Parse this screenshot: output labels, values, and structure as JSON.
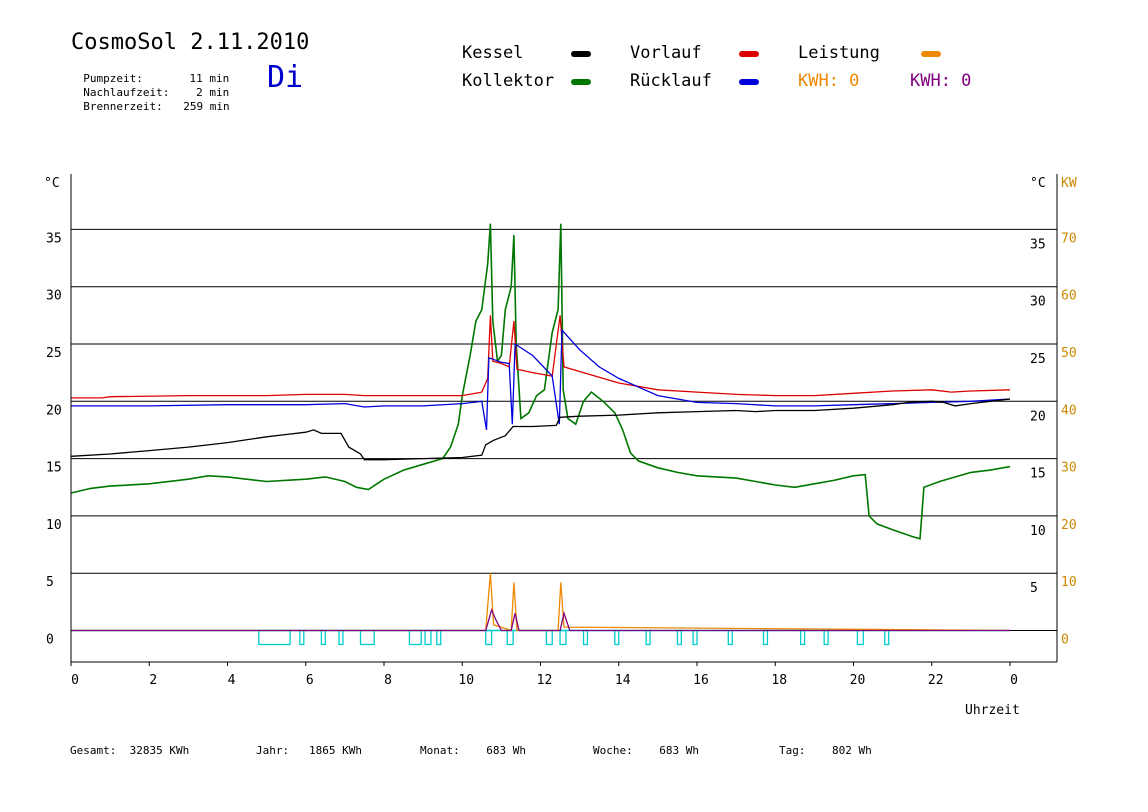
{
  "header": {
    "title": "CosmoSol 2.11.2010",
    "day": "Di",
    "pumpzeit_label": "Pumpzeit:",
    "pumpzeit_value": "11 min",
    "nachlaufzeit_label": "Nachlaufzeit:",
    "nachlaufzeit_value": "2 min",
    "brennerzeit_label": "Brennerzeit:",
    "brennerzeit_value": "259 min"
  },
  "legend": {
    "kessel": "Kessel",
    "kollektor": "Kollektor",
    "vorlauf": "Vorlauf",
    "ruecklauf": "Rücklauf",
    "leistung": "Leistung",
    "kwh1": "KWH: 0",
    "kwh2": "KWH: 0"
  },
  "footer": {
    "gesamt_label": "Gesamt:",
    "gesamt_value": "32835 KWh",
    "jahr_label": "Jahr:",
    "jahr_value": "1865 KWh",
    "monat_label": "Monat:",
    "monat_value": "683 Wh",
    "woche_label": "Woche:",
    "woche_value": "683 Wh",
    "tag_label": "Tag:",
    "tag_value": "802 Wh"
  },
  "colors": {
    "kessel": "#000000",
    "kollektor": "#007700",
    "vorlauf": "#dd0000",
    "ruecklauf": "#0000dd",
    "leistung": "#ee8800",
    "kwh2": "#800080",
    "pump": "#00cccc",
    "axis_right_kw": "#cc8800"
  },
  "chart_data": {
    "type": "line",
    "x_unit_label": "Uhrzeit",
    "y_unit_left": "°C",
    "y_unit_right": "°C",
    "y2_unit": "KW",
    "xlim": [
      0,
      24
    ],
    "ylim": [
      -3,
      40
    ],
    "grid": "horizontal",
    "x_ticks": [
      {
        "v": 0,
        "label": "0"
      },
      {
        "v": 2,
        "label": "2"
      },
      {
        "v": 4,
        "label": "4"
      },
      {
        "v": 6,
        "label": "6"
      },
      {
        "v": 8,
        "label": "8"
      },
      {
        "v": 10,
        "label": "10"
      },
      {
        "v": 12,
        "label": "12"
      },
      {
        "v": 14,
        "label": "14"
      },
      {
        "v": 16,
        "label": "16"
      },
      {
        "v": 18,
        "label": "18"
      },
      {
        "v": 20,
        "label": "20"
      },
      {
        "v": 22,
        "label": "22"
      },
      {
        "v": 24,
        "label": "0"
      }
    ],
    "y_ticks": [
      0,
      5,
      10,
      15,
      20,
      25,
      30,
      35
    ],
    "y2_ticks": [
      {
        "v": 0,
        "label": "0"
      },
      {
        "v": 5,
        "label": "10"
      },
      {
        "v": 10,
        "label": "20"
      },
      {
        "v": 15,
        "label": "30"
      },
      {
        "v": 20,
        "label": "40"
      },
      {
        "v": 25,
        "label": "50"
      },
      {
        "v": 30,
        "label": "60"
      },
      {
        "v": 35,
        "label": "70"
      }
    ],
    "series": [
      {
        "name": "Kessel",
        "key": "kessel",
        "points": [
          [
            0,
            15.2
          ],
          [
            1,
            15.4
          ],
          [
            2,
            15.7
          ],
          [
            3,
            16.0
          ],
          [
            4,
            16.4
          ],
          [
            5,
            16.9
          ],
          [
            5.5,
            17.1
          ],
          [
            6,
            17.3
          ],
          [
            6.2,
            17.5
          ],
          [
            6.4,
            17.2
          ],
          [
            6.9,
            17.2
          ],
          [
            7.1,
            16.0
          ],
          [
            7.4,
            15.4
          ],
          [
            7.5,
            14.9
          ],
          [
            8,
            14.9
          ],
          [
            9,
            15.0
          ],
          [
            10,
            15.1
          ],
          [
            10.5,
            15.3
          ],
          [
            10.6,
            16.2
          ],
          [
            10.8,
            16.6
          ],
          [
            11.1,
            17.0
          ],
          [
            11.3,
            17.8
          ],
          [
            11.8,
            17.8
          ],
          [
            12.4,
            17.9
          ],
          [
            12.5,
            18.6
          ],
          [
            13,
            18.7
          ],
          [
            14,
            18.8
          ],
          [
            15,
            19.0
          ],
          [
            16,
            19.1
          ],
          [
            17,
            19.2
          ],
          [
            17.5,
            19.1
          ],
          [
            18,
            19.2
          ],
          [
            19,
            19.2
          ],
          [
            20,
            19.4
          ],
          [
            21,
            19.7
          ],
          [
            21.4,
            19.9
          ],
          [
            22,
            20.0
          ],
          [
            22.3,
            19.9
          ],
          [
            22.6,
            19.6
          ],
          [
            23,
            19.8
          ],
          [
            24,
            20.2
          ]
        ]
      },
      {
        "name": "Kollektor",
        "key": "kollektor",
        "points": [
          [
            0,
            12.0
          ],
          [
            0.5,
            12.4
          ],
          [
            1,
            12.6
          ],
          [
            2,
            12.8
          ],
          [
            3,
            13.2
          ],
          [
            3.5,
            13.5
          ],
          [
            4,
            13.4
          ],
          [
            5,
            13.0
          ],
          [
            6,
            13.2
          ],
          [
            6.5,
            13.4
          ],
          [
            7,
            13.0
          ],
          [
            7.3,
            12.5
          ],
          [
            7.6,
            12.3
          ],
          [
            8,
            13.2
          ],
          [
            8.5,
            14.0
          ],
          [
            9,
            14.5
          ],
          [
            9.5,
            15.0
          ],
          [
            9.7,
            16.0
          ],
          [
            9.9,
            18.0
          ],
          [
            10,
            20.5
          ],
          [
            10.2,
            24.0
          ],
          [
            10.35,
            27.0
          ],
          [
            10.5,
            28.0
          ],
          [
            10.65,
            32.0
          ],
          [
            10.72,
            35.5
          ],
          [
            10.78,
            27.0
          ],
          [
            10.9,
            23.5
          ],
          [
            11.0,
            24.0
          ],
          [
            11.1,
            28.0
          ],
          [
            11.25,
            30.0
          ],
          [
            11.32,
            34.5
          ],
          [
            11.38,
            25.0
          ],
          [
            11.5,
            18.5
          ],
          [
            11.7,
            19.0
          ],
          [
            11.9,
            20.5
          ],
          [
            12.1,
            21.0
          ],
          [
            12.3,
            26.0
          ],
          [
            12.45,
            28.0
          ],
          [
            12.52,
            35.5
          ],
          [
            12.58,
            21.0
          ],
          [
            12.7,
            18.5
          ],
          [
            12.9,
            18.0
          ],
          [
            13.1,
            20.0
          ],
          [
            13.3,
            20.8
          ],
          [
            13.6,
            20.0
          ],
          [
            13.9,
            19.0
          ],
          [
            14.1,
            17.5
          ],
          [
            14.3,
            15.5
          ],
          [
            14.5,
            14.8
          ],
          [
            15,
            14.2
          ],
          [
            15.5,
            13.8
          ],
          [
            16,
            13.5
          ],
          [
            17,
            13.3
          ],
          [
            17.5,
            13.0
          ],
          [
            18,
            12.7
          ],
          [
            18.5,
            12.5
          ],
          [
            19,
            12.8
          ],
          [
            19.5,
            13.1
          ],
          [
            20,
            13.5
          ],
          [
            20.3,
            13.6
          ],
          [
            20.4,
            10.0
          ],
          [
            20.6,
            9.3
          ],
          [
            21,
            8.8
          ],
          [
            21.5,
            8.2
          ],
          [
            21.7,
            8.0
          ],
          [
            21.8,
            12.5
          ],
          [
            22.2,
            13.0
          ],
          [
            23,
            13.8
          ],
          [
            23.5,
            14.0
          ],
          [
            24,
            14.3
          ]
        ]
      },
      {
        "name": "Vorlauf",
        "key": "vorlauf",
        "points": [
          [
            0,
            20.3
          ],
          [
            0.8,
            20.3
          ],
          [
            1,
            20.4
          ],
          [
            3,
            20.5
          ],
          [
            5,
            20.5
          ],
          [
            6,
            20.6
          ],
          [
            7,
            20.6
          ],
          [
            7.5,
            20.5
          ],
          [
            8,
            20.5
          ],
          [
            9,
            20.5
          ],
          [
            10,
            20.5
          ],
          [
            10.5,
            20.8
          ],
          [
            10.65,
            22.0
          ],
          [
            10.72,
            27.5
          ],
          [
            10.78,
            23.5
          ],
          [
            11,
            23.3
          ],
          [
            11.2,
            23.0
          ],
          [
            11.32,
            27.0
          ],
          [
            11.4,
            22.8
          ],
          [
            11.8,
            22.5
          ],
          [
            12.3,
            22.2
          ],
          [
            12.5,
            27.5
          ],
          [
            12.6,
            23.0
          ],
          [
            13,
            22.6
          ],
          [
            14,
            21.6
          ],
          [
            15,
            21.0
          ],
          [
            16,
            20.8
          ],
          [
            17,
            20.6
          ],
          [
            18,
            20.5
          ],
          [
            19,
            20.5
          ],
          [
            20,
            20.7
          ],
          [
            21,
            20.9
          ],
          [
            22,
            21.0
          ],
          [
            22.5,
            20.8
          ],
          [
            23,
            20.9
          ],
          [
            24,
            21.0
          ]
        ]
      },
      {
        "name": "Rücklauf",
        "key": "ruecklauf",
        "points": [
          [
            0,
            19.6
          ],
          [
            2,
            19.6
          ],
          [
            4,
            19.7
          ],
          [
            6,
            19.7
          ],
          [
            7,
            19.8
          ],
          [
            7.5,
            19.5
          ],
          [
            8,
            19.6
          ],
          [
            9,
            19.6
          ],
          [
            10,
            19.8
          ],
          [
            10.5,
            20.0
          ],
          [
            10.62,
            17.5
          ],
          [
            10.68,
            23.8
          ],
          [
            11,
            23.4
          ],
          [
            11.2,
            23.3
          ],
          [
            11.28,
            18.0
          ],
          [
            11.35,
            25.0
          ],
          [
            11.8,
            24.0
          ],
          [
            12.3,
            22.2
          ],
          [
            12.48,
            18.0
          ],
          [
            12.55,
            26.2
          ],
          [
            13,
            24.5
          ],
          [
            13.5,
            23.0
          ],
          [
            14,
            22.0
          ],
          [
            15,
            20.5
          ],
          [
            16,
            19.9
          ],
          [
            17,
            19.8
          ],
          [
            18,
            19.6
          ],
          [
            19,
            19.6
          ],
          [
            20,
            19.7
          ],
          [
            21,
            19.8
          ],
          [
            22,
            19.9
          ],
          [
            23,
            20.0
          ],
          [
            24,
            20.2
          ]
        ]
      },
      {
        "name": "Leistung",
        "key": "leistung",
        "points": [
          [
            0,
            0
          ],
          [
            10.6,
            0
          ],
          [
            10.72,
            5.0
          ],
          [
            10.8,
            0.5
          ],
          [
            11.25,
            0
          ],
          [
            11.32,
            4.2
          ],
          [
            11.4,
            0
          ],
          [
            12.45,
            0
          ],
          [
            12.52,
            4.2
          ],
          [
            12.6,
            0.3
          ],
          [
            24,
            0
          ]
        ]
      },
      {
        "name": "KWH",
        "key": "kwh2",
        "points": [
          [
            0,
            0
          ],
          [
            10.6,
            0
          ],
          [
            10.75,
            1.8
          ],
          [
            10.85,
            1.0
          ],
          [
            11,
            0
          ],
          [
            11.25,
            0
          ],
          [
            11.35,
            1.5
          ],
          [
            11.45,
            0
          ],
          [
            12.5,
            0
          ],
          [
            12.6,
            1.5
          ],
          [
            12.75,
            0
          ],
          [
            24,
            0
          ]
        ]
      }
    ],
    "pump_intervals": [
      [
        4.8,
        5.6
      ],
      [
        5.85,
        5.95
      ],
      [
        6.4,
        6.5
      ],
      [
        6.85,
        6.95
      ],
      [
        7.4,
        7.75
      ],
      [
        8.65,
        8.95
      ],
      [
        9.05,
        9.2
      ],
      [
        9.35,
        9.45
      ],
      [
        10.6,
        10.75
      ],
      [
        11.15,
        11.3
      ],
      [
        12.15,
        12.3
      ],
      [
        12.5,
        12.65
      ],
      [
        13.1,
        13.2
      ],
      [
        13.9,
        14.0
      ],
      [
        14.7,
        14.8
      ],
      [
        15.5,
        15.6
      ],
      [
        15.9,
        16.0
      ],
      [
        16.8,
        16.9
      ],
      [
        17.7,
        17.8
      ],
      [
        18.65,
        18.75
      ],
      [
        19.25,
        19.35
      ],
      [
        20.1,
        20.25
      ],
      [
        20.8,
        20.9
      ]
    ]
  }
}
